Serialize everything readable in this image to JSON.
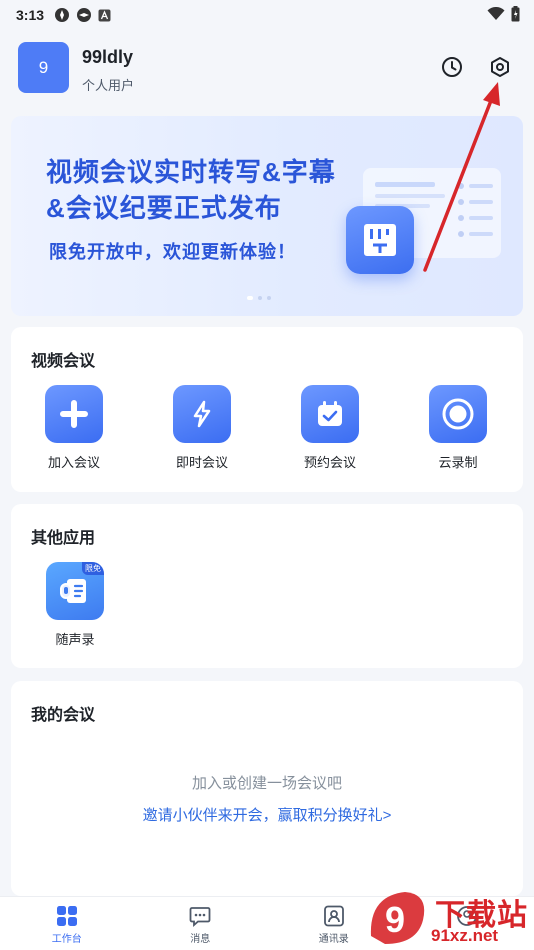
{
  "status_bar": {
    "time": "3:13"
  },
  "header": {
    "avatar_text": "9",
    "username": "99ldly",
    "user_type": "个人用户",
    "icons": [
      "clock-icon",
      "settings-hex-icon"
    ]
  },
  "banner": {
    "title_line1": "视频会议实时转写&字幕",
    "title_line2": "&会议纪要正式发布",
    "subtitle": "限免开放中，欢迎更新体验！",
    "page_count": 3,
    "active_page": 1
  },
  "video_meeting": {
    "title": "视频会议",
    "items": [
      {
        "label": "加入会议",
        "icon": "plus-icon"
      },
      {
        "label": "即时会议",
        "icon": "lightning-icon"
      },
      {
        "label": "预约会议",
        "icon": "calendar-check-icon"
      },
      {
        "label": "云录制",
        "icon": "record-icon"
      }
    ]
  },
  "other_apps": {
    "title": "其他应用",
    "items": [
      {
        "label": "随声录",
        "icon": "voice-note-icon",
        "badge": "限免"
      }
    ]
  },
  "my_meetings": {
    "title": "我的会议",
    "empty_text": "加入或创建一场会议吧",
    "invite_link": "邀请小伙伴来开会，赢取积分换好礼>"
  },
  "bottom_nav": {
    "items": [
      {
        "label": "工作台",
        "icon": "grid-icon",
        "active": true
      },
      {
        "label": "消息",
        "icon": "chat-icon",
        "active": false
      },
      {
        "label": "通讯录",
        "icon": "contacts-icon",
        "active": false
      },
      {
        "label": "",
        "icon": "profile-icon",
        "active": false
      }
    ]
  },
  "colors": {
    "accent": "#3b6df2",
    "link": "#2f6ae0",
    "annotation": "#d7262a"
  },
  "watermark": {
    "title": "下载站",
    "url": "91xz.net",
    "logo": "9"
  }
}
